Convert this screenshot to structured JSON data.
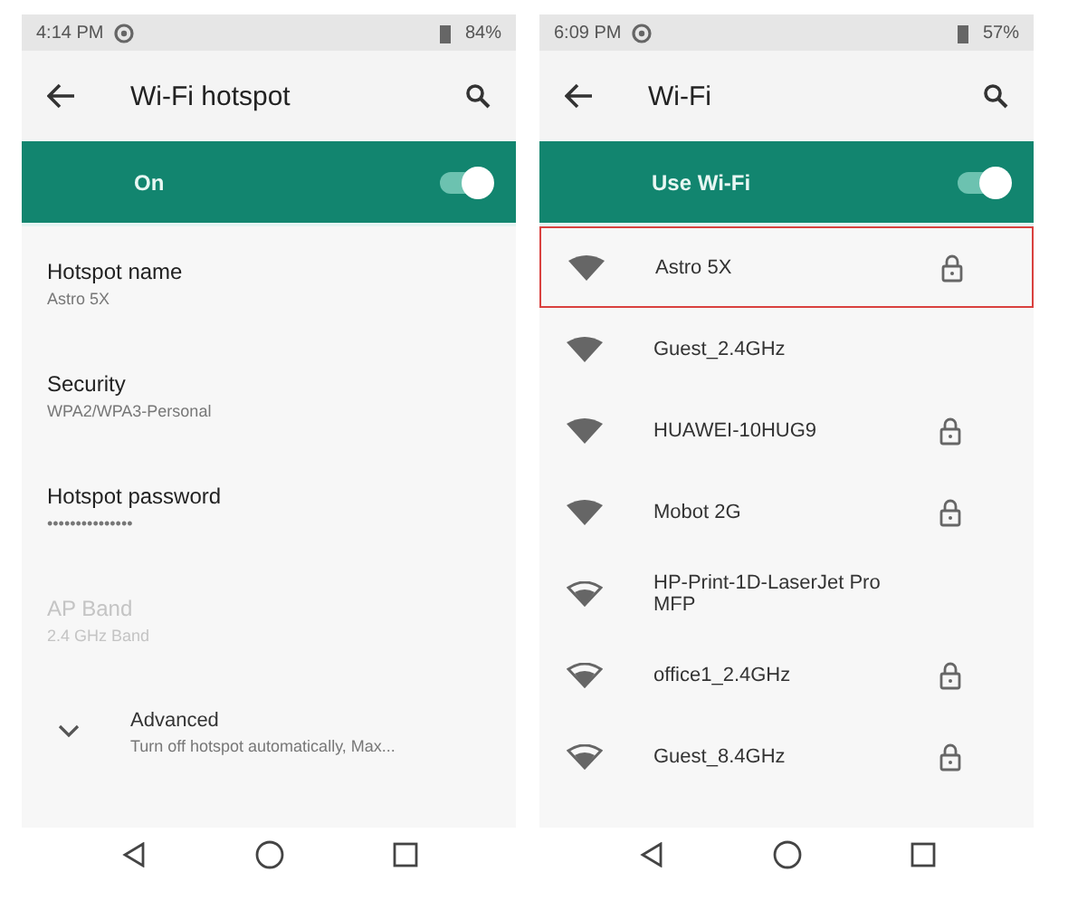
{
  "phones": [
    {
      "status_bar": {
        "time": "4:14 PM",
        "battery": "84%"
      },
      "title": "Wi-Fi hotspot",
      "master_switch": {
        "label": "On",
        "on": true
      },
      "settings": [
        {
          "kind": "setting",
          "title": "Hotspot name",
          "value": "Astro 5X",
          "disabled": false
        },
        {
          "kind": "setting",
          "title": "Security",
          "value": "WPA2/WPA3-Personal",
          "disabled": false
        },
        {
          "kind": "setting",
          "title": "Hotspot password",
          "value": "•••••••••••••••",
          "disabled": false
        },
        {
          "kind": "setting",
          "title": "AP Band",
          "value": "2.4 GHz Band",
          "disabled": true
        },
        {
          "kind": "expander",
          "title": "Advanced",
          "value": "Turn off hotspot automatically, Max...",
          "disabled": false
        }
      ]
    },
    {
      "status_bar": {
        "time": "6:09 PM",
        "battery": "57%"
      },
      "title": "Wi-Fi",
      "master_switch": {
        "label": "Use Wi-Fi",
        "on": true
      },
      "networks": [
        {
          "name": "Astro 5X",
          "kind": "full",
          "locked": true,
          "highlighted": true
        },
        {
          "name": "Guest_2.4GHz",
          "kind": "full",
          "locked": false,
          "highlighted": false
        },
        {
          "name": "HUAWEI-10HUG9",
          "kind": "full",
          "locked": true,
          "highlighted": false
        },
        {
          "name": "Mobot 2G",
          "kind": "full",
          "locked": true,
          "highlighted": false
        },
        {
          "name": "HP-Print-1D-LaserJet Pro MFP",
          "kind": "partial",
          "locked": false,
          "highlighted": false
        },
        {
          "name": "office1_2.4GHz",
          "kind": "partial",
          "locked": true,
          "highlighted": false
        },
        {
          "name": "Guest_8.4GHz",
          "kind": "partial",
          "locked": true,
          "highlighted": false
        }
      ]
    }
  ]
}
